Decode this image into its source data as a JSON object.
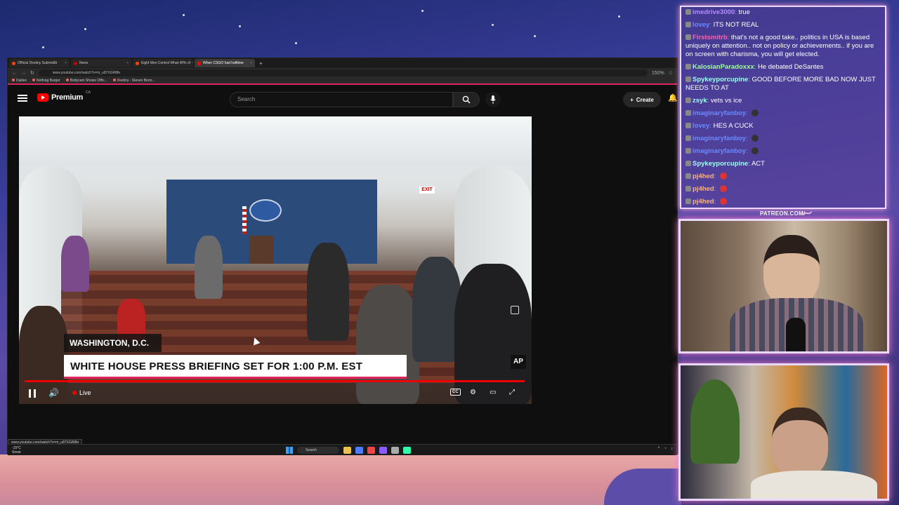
{
  "browser": {
    "tabs": [
      {
        "label": "Official Destiny Subreddit",
        "active": false
      },
      {
        "label": "News",
        "active": false
      },
      {
        "label": "Eight Men Control What 40% of",
        "active": false
      },
      {
        "label": "When CSGO had halftime",
        "active": true
      }
    ],
    "url": "www.youtube.com/watch?v=m_u87XGR8fe",
    "zoom": "150%",
    "bookmarks": [
      "Dailies",
      "Nothing Burger",
      "Bodycam Shows Offic...",
      "Destiny - Steven Bonn..."
    ]
  },
  "youtube": {
    "brand": "Premium",
    "region": "CA",
    "search_placeholder": "Search",
    "create_label": "Create"
  },
  "video": {
    "location": "WASHINGTON, D.C.",
    "headline": "WHITE HOUSE PRESS BRIEFING SET FOR 1:00 P.M. EST",
    "ap_label": "AP",
    "exit_sign": "EXIT",
    "live_label": "Live",
    "cc_label": "CC"
  },
  "status_url": "www.youtube.com/watch?v=m_u87XGR8fe",
  "taskbar": {
    "weather_temp": "-15°C",
    "weather_desc": "Snow",
    "search_label": "Search"
  },
  "chat": [
    {
      "user": "imedrive3000",
      "color": "#b48bff",
      "text": "true"
    },
    {
      "user": "lovey",
      "color": "#6a8cff",
      "text": "ITS NOT REAL"
    },
    {
      "user": "Firstsmitrb",
      "color": "#ff5fa8",
      "text": "that's not a good take.. politics in USA is based uniquely on attention.. not on policy or achievements.. if you are on screen with charisma, you will get elected."
    },
    {
      "user": "KalosianParadoxxx",
      "color": "#9dff9d",
      "text": "He debated DeSantes"
    },
    {
      "user": "Spykeyporcupine",
      "color": "#9dfff0",
      "text": "GOOD BEFORE MORE BAD NOW JUST NEEDS TO AT"
    },
    {
      "user": "zsyk",
      "color": "#9dfff0",
      "text": "vets vs ice"
    },
    {
      "user": "imaginaryfanboy",
      "color": "#6a8cff",
      "text": ""
    },
    {
      "user": "lovey",
      "color": "#6a8cff",
      "text": "HES A CUCK"
    },
    {
      "user": "imaginaryfanboy",
      "color": "#6a8cff",
      "text": ""
    },
    {
      "user": "imaginaryfanboy",
      "color": "#6a8cff",
      "text": ""
    },
    {
      "user": "Spykeyporcupine",
      "color": "#9dfff0",
      "text": "ACT"
    },
    {
      "user": "pj4hed",
      "color": "#ffb37a",
      "text": ""
    },
    {
      "user": "pj4hed",
      "color": "#ffb37a",
      "text": ""
    },
    {
      "user": "pj4hed",
      "color": "#ffb37a",
      "text": ""
    }
  ],
  "overlay": {
    "patreon": "PATREON.COM/"
  }
}
